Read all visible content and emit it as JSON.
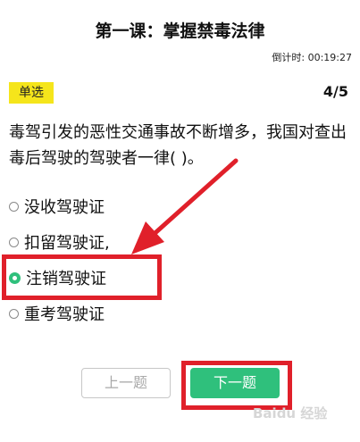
{
  "header": {
    "title": "第一课：掌握禁毒法律",
    "timer": "倒计时: 00:19:27"
  },
  "question": {
    "type_label": "单选",
    "progress": "4/5",
    "text": "毒驾引发的恶性交通事故不断增多，我国对查出毒后驾驶的驾驶者一律( )。",
    "options": [
      {
        "label": "没收驾驶证",
        "selected": false
      },
      {
        "label": "扣留驾驶证,",
        "selected": false
      },
      {
        "label": "注销驾驶证",
        "selected": true
      },
      {
        "label": "重考驾驶证",
        "selected": false
      }
    ]
  },
  "buttons": {
    "prev_label": "上一题",
    "next_label": "下一题"
  },
  "watermark": "Baidu 经验",
  "colors": {
    "accent_green": "#2fc07c",
    "badge_yellow": "#f5e51b",
    "annotation_red": "#e0202a"
  }
}
